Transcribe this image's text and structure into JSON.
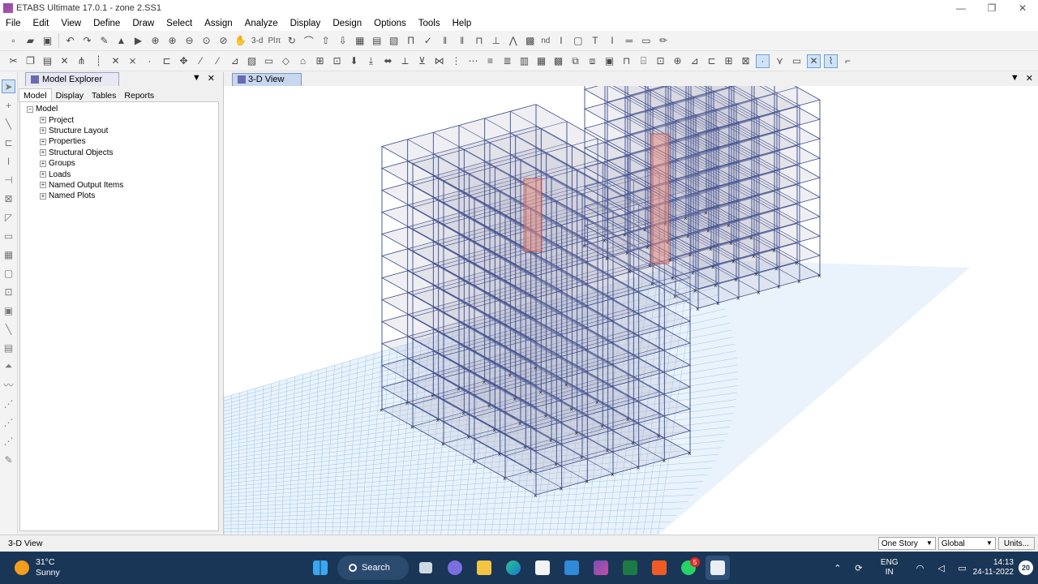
{
  "window": {
    "title": "ETABS Ultimate 17.0.1 - zone 2.SS1",
    "minimize": "—",
    "maximize": "❐",
    "close": "✕"
  },
  "menu": [
    "File",
    "Edit",
    "View",
    "Define",
    "Draw",
    "Select",
    "Assign",
    "Analyze",
    "Display",
    "Design",
    "Options",
    "Tools",
    "Help"
  ],
  "toolbar": {
    "three_d_label": "3-d",
    "plan_label": "Plπ",
    "nd_label": "nd"
  },
  "explorer": {
    "title": "Model Explorer",
    "tabs": [
      "Model",
      "Display",
      "Tables",
      "Reports"
    ],
    "root": "Model",
    "items": [
      "Project",
      "Structure Layout",
      "Properties",
      "Structural Objects",
      "Groups",
      "Loads",
      "Named Output Items",
      "Named Plots"
    ]
  },
  "view": {
    "title": "3-D View"
  },
  "statusbar": {
    "text": "3-D View",
    "story": "One Story",
    "coords": "Global",
    "units": "Units..."
  },
  "taskbar": {
    "temperature": "31°C",
    "weather": "Sunny",
    "search": "Search",
    "whatsapp_badge": "5",
    "language": "ENG",
    "region": "IN",
    "time": "14:13",
    "date": "24-11-2022",
    "notifications": "20"
  },
  "colors": {
    "taskbar": "#1a3656",
    "grid": "#9cc7ea",
    "frame": "#3b4a8a",
    "slab": "#b8b8c8",
    "wall": "#e8897a"
  }
}
